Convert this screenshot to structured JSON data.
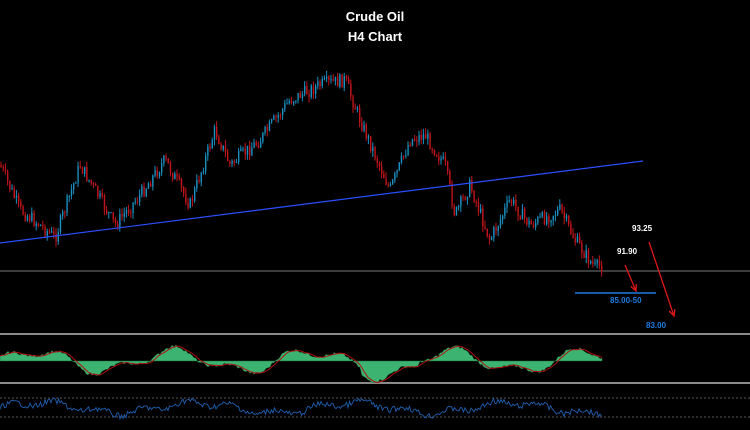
{
  "chart_data": {
    "type": "candlestick",
    "title": "Crude Oil",
    "subtitle": "H4 Chart",
    "annotations": [
      {
        "label": "93.25",
        "color": "#ffffff"
      },
      {
        "label": "91.90",
        "color": "#ffffff"
      },
      {
        "label": "85.00-50",
        "color": "#1e7be0"
      },
      {
        "label": "83.00",
        "color": "#1e7be0"
      }
    ],
    "colors": {
      "up": "#1a8fc0",
      "down": "#c0141a",
      "trendline": "#2b4fff",
      "target_line": "#1e7be0",
      "arrow": "#e01818",
      "hist": "#3cb371",
      "signal": "#b01010",
      "oscillator": "#1f5fb0"
    },
    "indicators": [
      "histogram-oscillator",
      "line-oscillator"
    ]
  }
}
